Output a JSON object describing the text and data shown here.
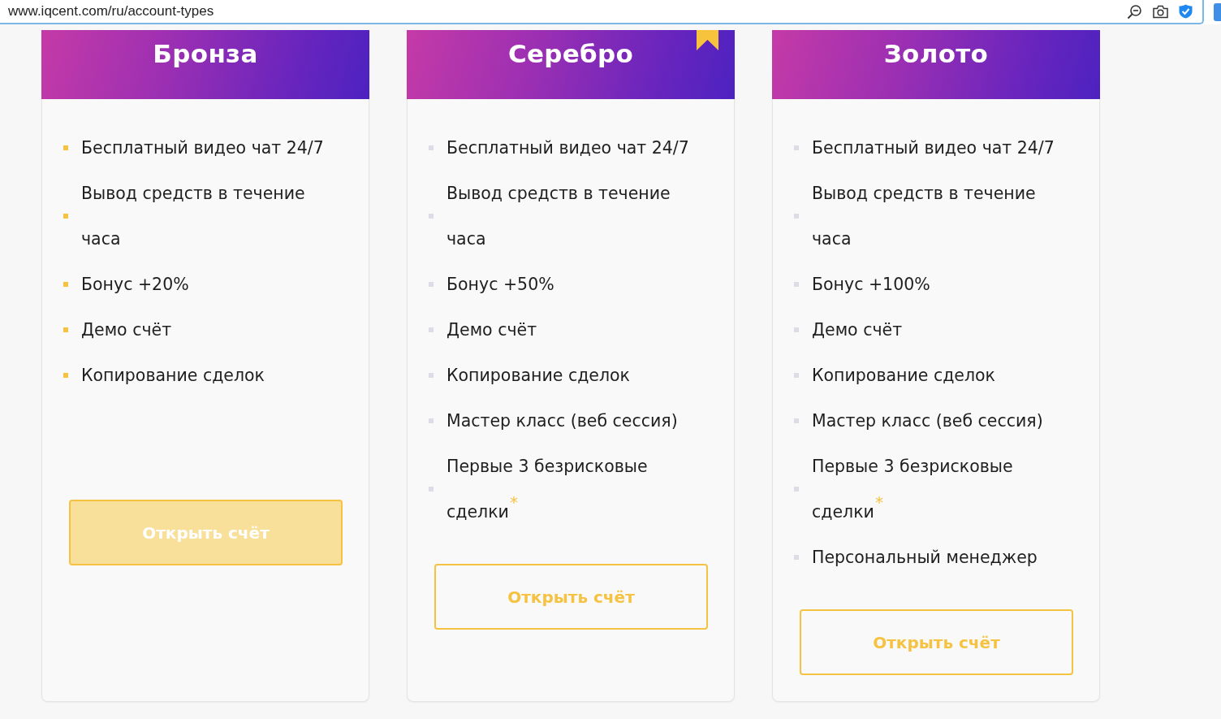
{
  "browser": {
    "url": "www.iqcent.com/ru/account-types"
  },
  "plans": [
    {
      "name": "Бронза",
      "featured": false,
      "hovered": true,
      "features": [
        "Бесплатный видео чат 24/7",
        "Вывод средств в течение часа",
        "Бонус +20%",
        "Демо счёт",
        "Копирование сделок"
      ],
      "button": "Открыть счёт"
    },
    {
      "name": "Серебро",
      "featured": true,
      "hovered": false,
      "features": [
        "Бесплатный видео чат 24/7",
        "Вывод средств в течение часа",
        "Бонус +50%",
        "Демо счёт",
        "Копирование сделок",
        "Мастер класс (веб сессия)",
        "Первые 3 безрисковые сделки$^{*}$"
      ],
      "button": "Открыть счёт"
    },
    {
      "name": "Золото",
      "featured": false,
      "hovered": false,
      "features": [
        "Бесплатный видео чат 24/7",
        "Вывод средств в течение часа",
        "Бонус +100%",
        "Демо счёт",
        "Копирование сделок",
        "Мастер класс (веб сессия)",
        "Первые 3 безрисковые сделки$^{*}$",
        "Персональный менеджер"
      ],
      "button": "Открыть счёт"
    }
  ]
}
